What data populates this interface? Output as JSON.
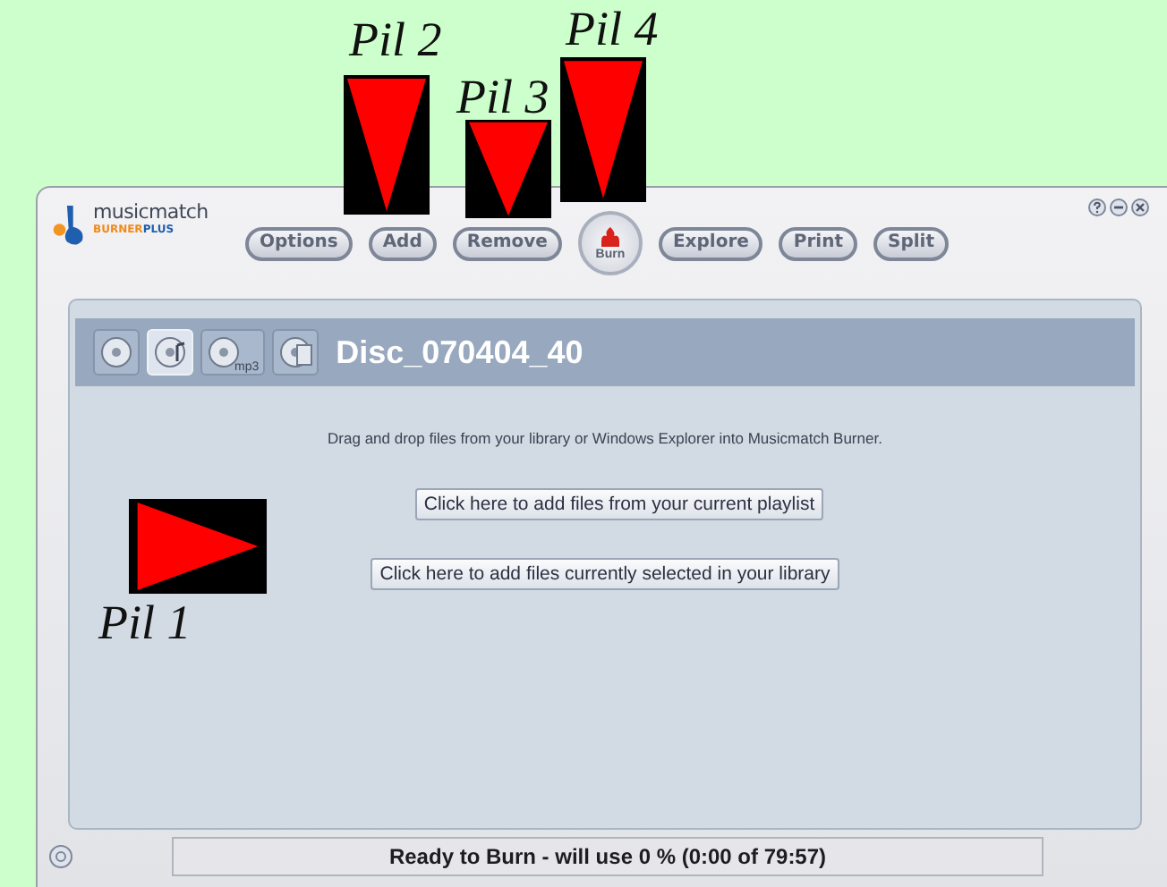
{
  "logo": {
    "name": "musicmatch",
    "sub_orange": "BURNER",
    "sub_blue": "PLUS"
  },
  "window_controls": [
    {
      "kind": "help"
    },
    {
      "kind": "minimize"
    },
    {
      "kind": "close"
    }
  ],
  "toolbar": [
    {
      "label": "Options",
      "kind": "pill"
    },
    {
      "label": "Add",
      "kind": "pill"
    },
    {
      "label": "Remove",
      "kind": "pill"
    },
    {
      "label": "Burn",
      "kind": "round"
    },
    {
      "label": "Explore",
      "kind": "pill"
    },
    {
      "label": "Print",
      "kind": "pill"
    },
    {
      "label": "Split",
      "kind": "pill"
    }
  ],
  "views": [
    {
      "kind": "disc",
      "selected": false
    },
    {
      "kind": "audio",
      "selected": true
    },
    {
      "kind": "mp3",
      "label": "mp3",
      "selected": false
    },
    {
      "kind": "data",
      "selected": false
    }
  ],
  "disc_title": "Disc_070404_40",
  "hint": "Drag and drop files from your library or Windows Explorer into Musicmatch Burner.",
  "actions": [
    "Click here to add files from your current playlist",
    "Click here to add files currently selected in your library"
  ],
  "status": "Ready to Burn - will use 0 % (0:00 of 79:57)",
  "annotations": [
    {
      "label": "Pil 1",
      "kind": "right"
    },
    {
      "label": "Pil 2",
      "kind": "down"
    },
    {
      "label": "Pil 3",
      "kind": "down"
    },
    {
      "label": "Pil 4",
      "kind": "down"
    }
  ]
}
